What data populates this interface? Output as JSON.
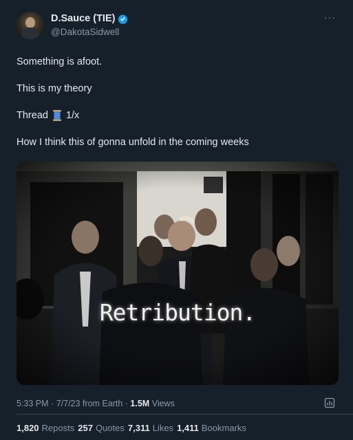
{
  "author": {
    "display_name": "D.Sauce (TIE)",
    "handle": "@DakotaSidwell",
    "more_label": "···"
  },
  "tweet": {
    "line1": "Something is afoot.",
    "line2": "This is my theory",
    "line3": "Thread",
    "line3_suffix": "1/x",
    "line4": "How I think this of gonna unfold in the coming weeks"
  },
  "media": {
    "overlay_text": "Retribution."
  },
  "meta": {
    "time": "5:33 PM",
    "sep1": "·",
    "date": "7/7/23 from Earth",
    "sep2": "·",
    "views_count": "1.5M",
    "views_label": "Views"
  },
  "stats": {
    "reposts_count": "1,820",
    "reposts_label": "Reposts",
    "quotes_count": "257",
    "quotes_label": "Quotes",
    "likes_count": "7,311",
    "likes_label": "Likes",
    "bookmarks_count": "1,411",
    "bookmarks_label": "Bookmarks"
  },
  "colors": {
    "background": "#15202b",
    "verified": "#1d9bf0",
    "secondary_text": "#8b98a5"
  }
}
